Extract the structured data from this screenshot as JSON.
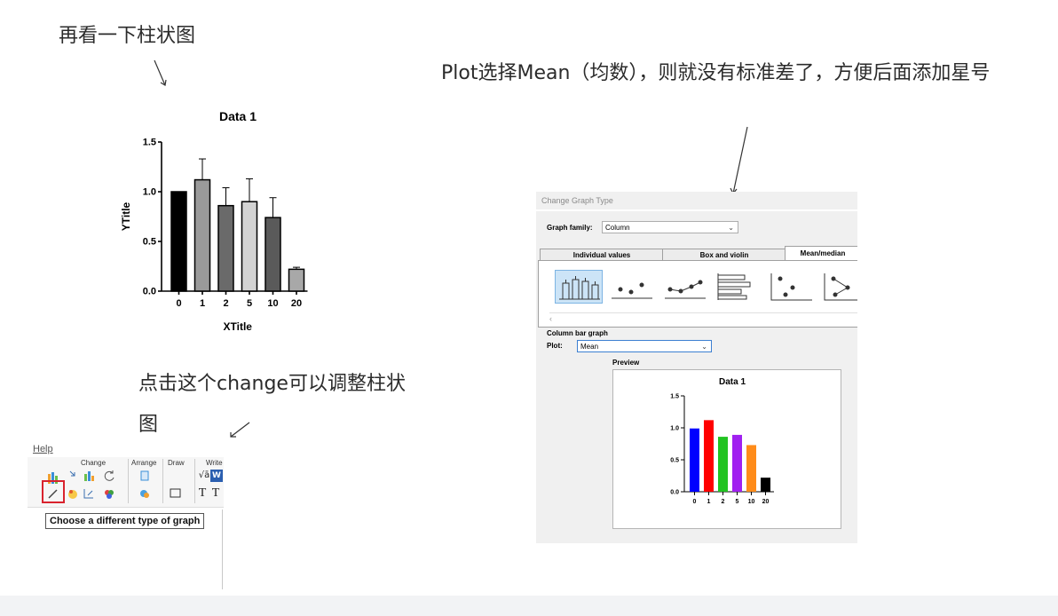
{
  "annotations": {
    "look_again": "再看一下柱状图",
    "plot_mean": "Plot选择Mean（均数），则就没有标准差了，方便后面添加星号",
    "click_change": "点击这个change可以调整柱状图"
  },
  "top_chart": {
    "chart_data": {
      "type": "bar",
      "title": "Data 1",
      "xlabel": "XTitle",
      "ylabel": "YTitle",
      "categories": [
        "0",
        "1",
        "2",
        "5",
        "10",
        "20"
      ],
      "values": [
        1.0,
        1.12,
        0.86,
        0.9,
        0.74,
        0.22
      ],
      "error_bars": [
        0,
        0.21,
        0.18,
        0.23,
        0.2,
        0.02
      ],
      "ylim": [
        0,
        1.5
      ],
      "yticks": [
        "0.0",
        "0.5",
        "1.0",
        "1.5"
      ],
      "colors": [
        "#000000",
        "#9a9a9a",
        "#6a6a6a",
        "#d3d3d3",
        "#5a5a5a",
        "#a8a8a8"
      ]
    }
  },
  "toolbar": {
    "menu_help": "Help",
    "group_change": "Change",
    "group_arrange": "Arrange",
    "group_draw": "Draw",
    "group_write": "Write",
    "write_icons": [
      "√ā",
      "W",
      "T",
      "T"
    ],
    "tooltip": "Choose a different type of graph"
  },
  "dialog": {
    "title": "Change Graph Type",
    "graph_family_label": "Graph family:",
    "graph_family_value": "Column",
    "tabs": [
      "Individual values",
      "Box and violin",
      "Mean/median"
    ],
    "active_tab": "Mean/median",
    "section_label": "Column bar graph",
    "plot_label": "Plot:",
    "plot_value": "Mean",
    "preview_label": "Preview",
    "scroll_arrow": "‹",
    "preview_chart": {
      "chart_data": {
        "type": "bar",
        "title": "Data 1",
        "categories": [
          "0",
          "1",
          "2",
          "5",
          "10",
          "20"
        ],
        "values": [
          0.99,
          1.12,
          0.86,
          0.89,
          0.73,
          0.22
        ],
        "ylim": [
          0,
          1.5
        ],
        "yticks": [
          "0.0",
          "0.5",
          "1.0",
          "1.5"
        ],
        "colors": [
          "#0000ff",
          "#ff0000",
          "#22c322",
          "#a020f0",
          "#ff8c1a",
          "#000000"
        ]
      }
    }
  }
}
